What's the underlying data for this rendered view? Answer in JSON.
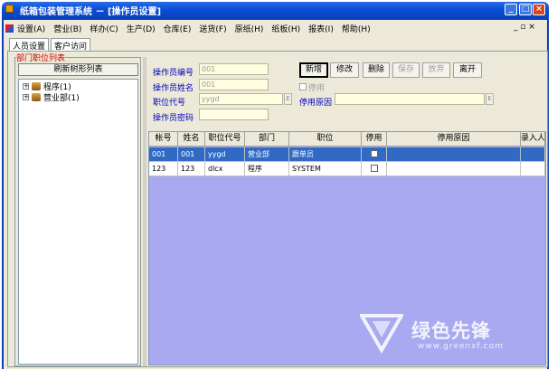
{
  "window": {
    "title": "纸箱包装管理系统 － [操作员设置]",
    "min_glyph": "_",
    "max_glyph": "□",
    "close_glyph": "×"
  },
  "menu": [
    "设置(A)",
    "营业(B)",
    "样办(C)",
    "生产(D)",
    "仓库(E)",
    "送货(F)",
    "原纸(H)",
    "纸板(H)",
    "报表(I)",
    "帮助(H)"
  ],
  "mdi_controls": "_ ▫ ×",
  "tabs": [
    "人员设置",
    "客户访问"
  ],
  "left": {
    "group_title": "部门职位列表",
    "refresh_button": "刷新树形列表",
    "tree": [
      {
        "label": "程序(1)",
        "expander": "+"
      },
      {
        "label": "营业部(1)",
        "expander": "+"
      }
    ]
  },
  "form": {
    "op_no_label": "操作员编号",
    "op_no_value": "001",
    "op_name_label": "操作员姓名",
    "op_name_value": "001",
    "pos_code_label": "职位代号",
    "pos_code_value": "yygd",
    "pwd_label": "操作员密码",
    "pwd_value": "",
    "disable_label": "停用",
    "disable_reason_label": "停用原因",
    "disable_reason_value": "",
    "dropdown_glyph": "E"
  },
  "toolbar": {
    "add": "新增",
    "edit": "修改",
    "delete": "删除",
    "save": "保存",
    "discard": "放弃",
    "exit": "离开"
  },
  "grid": {
    "columns": [
      "帐号",
      "姓名",
      "职位代号",
      "部门",
      "职位",
      "停用",
      "停用原因",
      "录入人"
    ],
    "rows": [
      {
        "account": "001",
        "name": "001",
        "code": "yygd",
        "dept": "营业部",
        "position": "跟单员",
        "disabled": false,
        "reason": "",
        "entered_by": ""
      },
      {
        "account": "123",
        "name": "123",
        "code": "dlcx",
        "dept": "程序",
        "position": "SYSTEM",
        "disabled": false,
        "reason": "",
        "entered_by": ""
      }
    ]
  },
  "watermark": {
    "cn": "绿色先锋",
    "url": "www.greenxf.com"
  }
}
